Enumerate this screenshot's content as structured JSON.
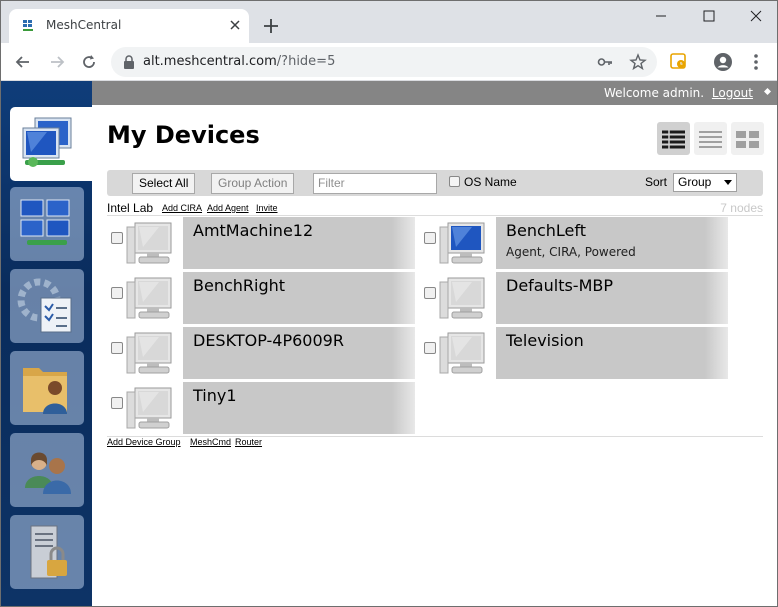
{
  "browser": {
    "tab_title": "MeshCentral",
    "url_host": "alt.meshcentral.com",
    "url_path": "/?hide=5"
  },
  "topbar": {
    "welcome": "Welcome admin.",
    "logout": "Logout"
  },
  "main": {
    "heading": "My Devices",
    "filterbar": {
      "select_all": "Select All",
      "group_action": "Group Action",
      "filter_placeholder": "Filter",
      "os_name_label": "OS Name",
      "sort_label": "Sort",
      "sort_value": "Group"
    },
    "group": {
      "name": "Intel Lab",
      "links": [
        "Add CIRA",
        "Add Agent",
        "Invite"
      ],
      "node_count": "7 nodes"
    },
    "devices": [
      {
        "name": "AmtMachine12",
        "status": "",
        "online": false
      },
      {
        "name": "BenchLeft",
        "status": "Agent, CIRA, Powered",
        "online": true
      },
      {
        "name": "BenchRight",
        "status": "",
        "online": false
      },
      {
        "name": "Defaults-MBP",
        "status": "",
        "online": false
      },
      {
        "name": "DESKTOP-4P6009R",
        "status": "",
        "online": false
      },
      {
        "name": "Television",
        "status": "",
        "online": false
      },
      {
        "name": "Tiny1",
        "status": "",
        "online": false
      }
    ],
    "footer_links": [
      "Add Device Group",
      "MeshCmd",
      "Router"
    ]
  },
  "sidebar": {
    "items": [
      "my-devices-icon",
      "my-desktop-icon",
      "server-settings-icon",
      "my-files-icon",
      "my-users-icon",
      "my-server-icon"
    ]
  },
  "colors": {
    "sidebar": "#0f3d7a",
    "topbar": "#858585",
    "device_card": "#c8c8c8"
  }
}
